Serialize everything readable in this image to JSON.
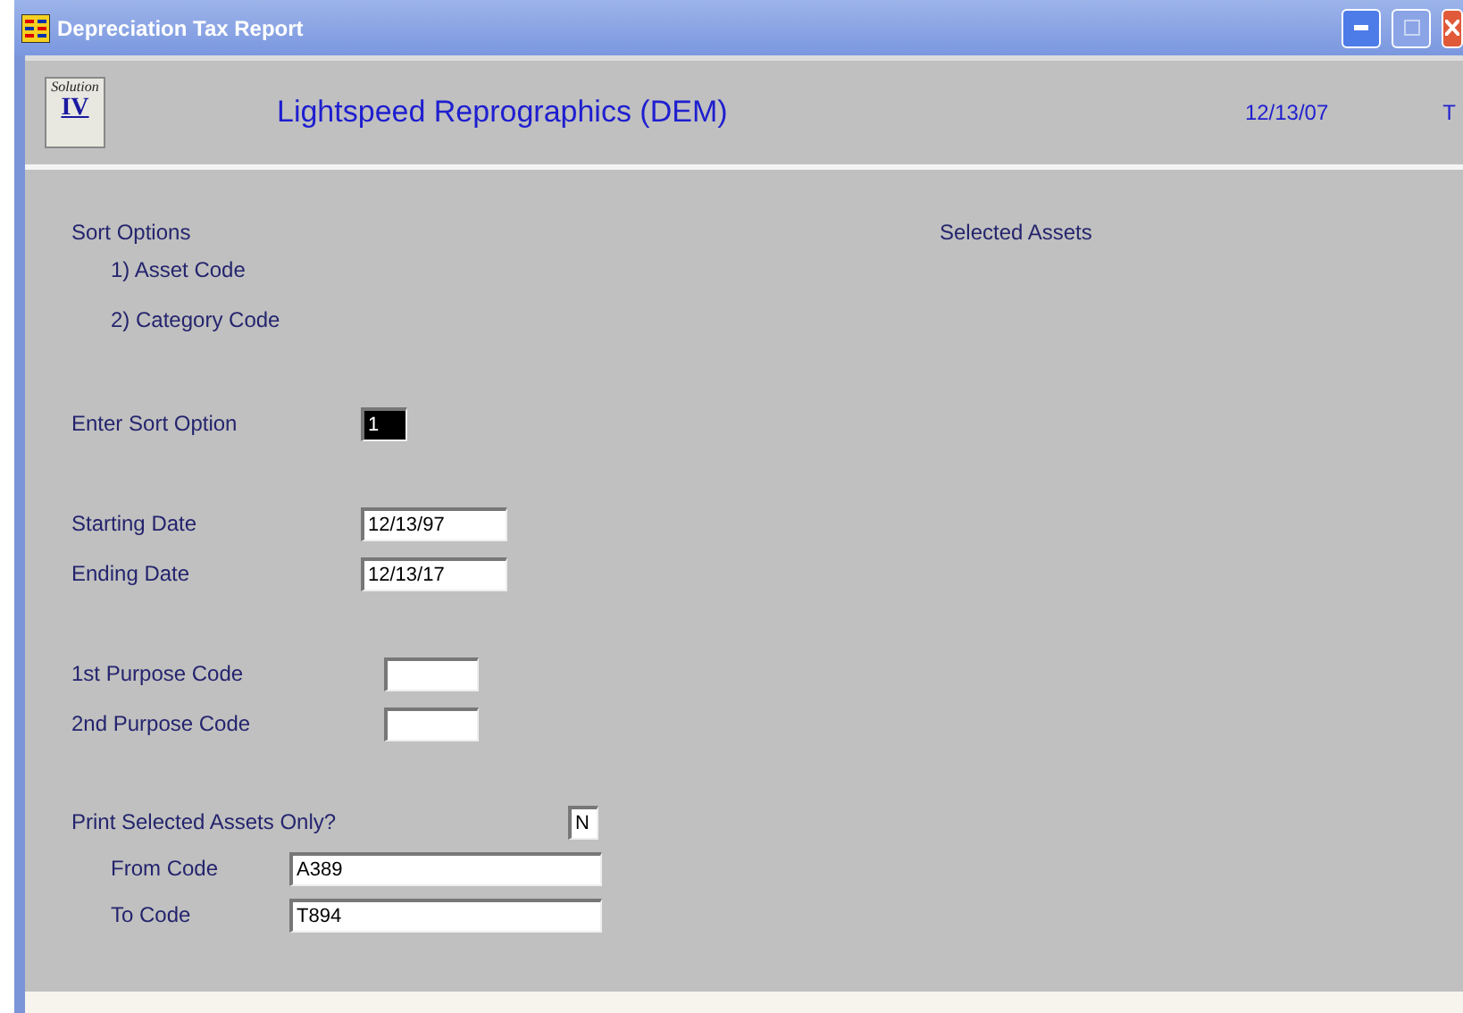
{
  "window": {
    "title": "Depreciation Tax Report"
  },
  "header": {
    "logo_text": "Solution",
    "logo_mark": "IV",
    "company": "Lightspeed Reprographics (DEM)",
    "date": "12/13/07",
    "user": "T"
  },
  "sort_options": {
    "heading": "Sort Options",
    "options": [
      "1) Asset Code",
      "2) Category Code"
    ]
  },
  "selected_assets_heading": "Selected Assets",
  "fields": [
    {
      "kind": "option",
      "label": "Enter Sort Option",
      "value": "1",
      "focused": true
    },
    {
      "kind": "date",
      "label": "Starting Date",
      "value": "12/13/97",
      "focused": false
    },
    {
      "kind": "date",
      "label": "Ending Date",
      "value": "12/13/17",
      "focused": false
    },
    {
      "kind": "purpose",
      "label": "1st Purpose Code",
      "focused": false
    },
    {
      "kind": "purpose",
      "label": "2nd Purpose Code",
      "focused": false
    },
    {
      "kind": "flag",
      "label": "Print Selected Assets Only?",
      "value": "N",
      "focused": false
    },
    {
      "kind": "range",
      "label": "From Code",
      "value": "A389",
      "focused": false
    },
    {
      "kind": "range",
      "label": "To Code",
      "value": "T894",
      "focused": false
    }
  ]
}
